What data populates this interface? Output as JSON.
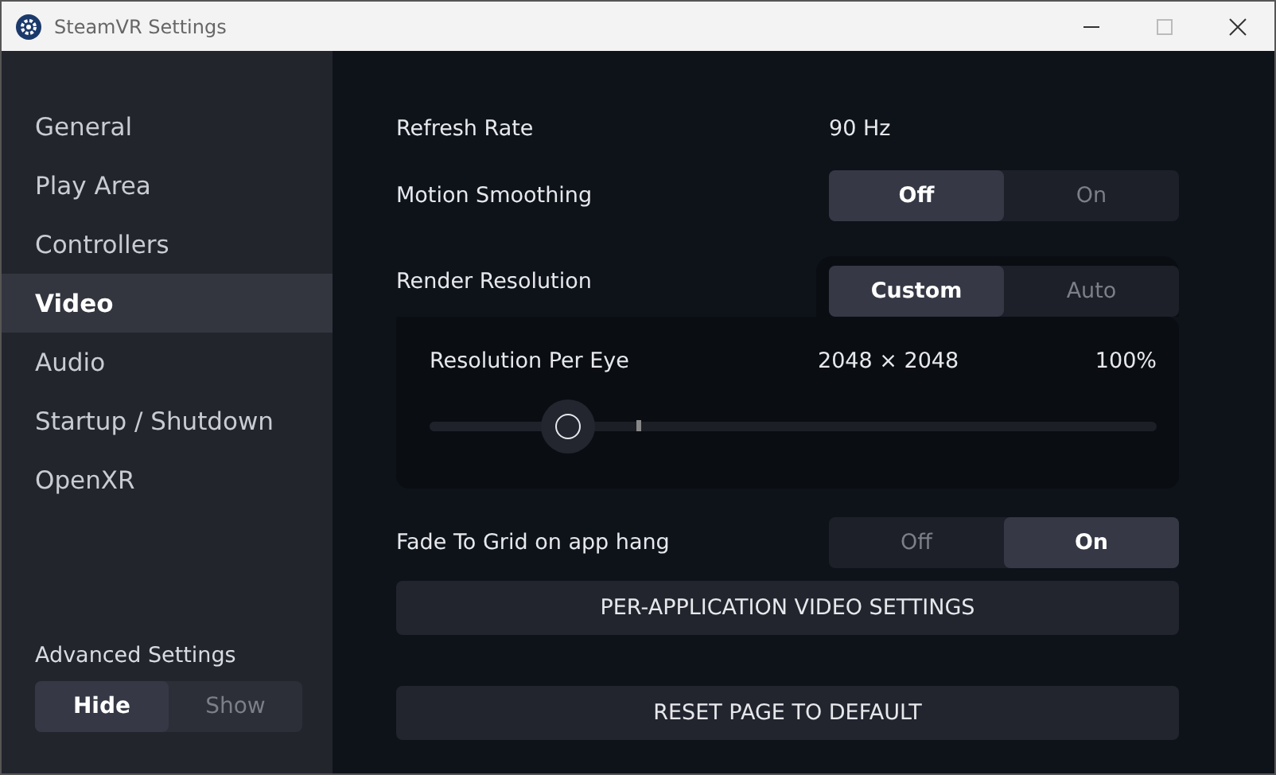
{
  "window": {
    "title": "SteamVR Settings"
  },
  "sidebar": {
    "items": [
      {
        "label": "General",
        "selected": false
      },
      {
        "label": "Play Area",
        "selected": false
      },
      {
        "label": "Controllers",
        "selected": false
      },
      {
        "label": "Video",
        "selected": true
      },
      {
        "label": "Audio",
        "selected": false
      },
      {
        "label": "Startup / Shutdown",
        "selected": false
      },
      {
        "label": "OpenXR",
        "selected": false
      }
    ],
    "advanced": {
      "label": "Advanced Settings",
      "options": [
        {
          "label": "Hide",
          "selected": true
        },
        {
          "label": "Show",
          "selected": false
        }
      ]
    }
  },
  "settings": [
    {
      "kind": "value",
      "label": "Refresh Rate",
      "value": "90 Hz"
    },
    {
      "kind": "toggle",
      "label": "Motion Smoothing",
      "options": [
        {
          "label": "Off",
          "selected": true
        },
        {
          "label": "On",
          "selected": false
        }
      ]
    },
    {
      "kind": "toggle-panel",
      "label": "Render Resolution",
      "options": [
        {
          "label": "Custom",
          "selected": true
        },
        {
          "label": "Auto",
          "selected": false
        }
      ],
      "panel": {
        "label": "Resolution Per Eye",
        "resolution": "2048 × 2048",
        "percent": "100%",
        "level": 0.19
      }
    },
    {
      "kind": "toggle",
      "label": "Fade To Grid on app hang",
      "options": [
        {
          "label": "Off",
          "selected": false
        },
        {
          "label": "On",
          "selected": true
        }
      ]
    }
  ],
  "buttons": [
    {
      "label": "PER-APPLICATION VIDEO SETTINGS"
    },
    {
      "label": "RESET PAGE TO DEFAULT"
    }
  ]
}
